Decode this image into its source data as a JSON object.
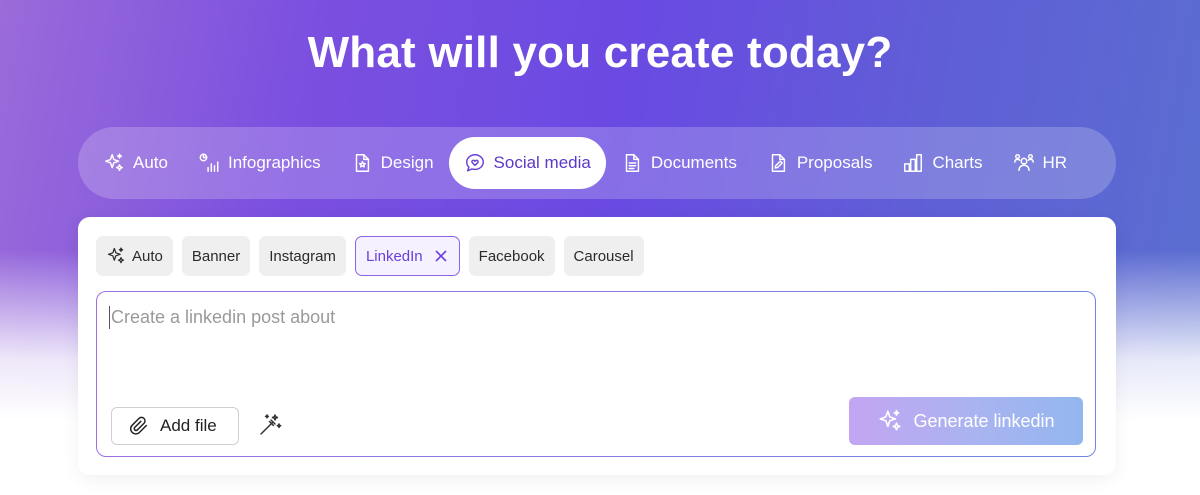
{
  "headline": "What will you create today?",
  "categories": [
    {
      "label": "Auto",
      "icon": "sparkles-icon"
    },
    {
      "label": "Infographics",
      "icon": "infographic-icon"
    },
    {
      "label": "Design",
      "icon": "design-icon"
    },
    {
      "label": "Social media",
      "icon": "chat-heart-icon",
      "active": true
    },
    {
      "label": "Documents",
      "icon": "document-icon"
    },
    {
      "label": "Proposals",
      "icon": "proposal-icon"
    },
    {
      "label": "Charts",
      "icon": "bar-chart-icon"
    },
    {
      "label": "HR",
      "icon": "people-icon"
    }
  ],
  "chips": [
    {
      "label": "Auto",
      "icon": "sparkles-icon"
    },
    {
      "label": "Banner"
    },
    {
      "label": "Instagram"
    },
    {
      "label": "LinkedIn",
      "selected": true
    },
    {
      "label": "Facebook"
    },
    {
      "label": "Carousel"
    }
  ],
  "prompt": {
    "placeholder": "Create a linkedin post about",
    "value": ""
  },
  "actions": {
    "add_file": "Add file",
    "generate": "Generate linkedin"
  },
  "colors": {
    "accent": "#6a40d8",
    "chip_bg": "#efefef",
    "generate_start": "#c3a5f2",
    "generate_end": "#93b6ef"
  }
}
